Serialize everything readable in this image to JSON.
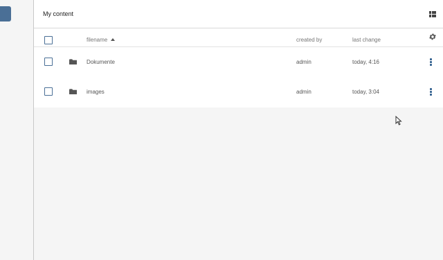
{
  "topbar": {
    "title": "My content",
    "view_toggle_icon": "grid-view-icon"
  },
  "filelist": {
    "columns": {
      "filename": "filename",
      "created_by": "created by",
      "last_change": "last change"
    },
    "sort": {
      "column": "filename",
      "direction": "ascending"
    },
    "rows": [
      {
        "name": "Dokumente",
        "created_by": "admin",
        "last_change": "today, 4:16",
        "icon": "folder-icon"
      },
      {
        "name": "images",
        "created_by": "admin",
        "last_change": "today, 3:04",
        "icon": "folder-icon"
      }
    ]
  },
  "colors": {
    "accent": "#4a6f96",
    "kebab": "#2a5a8a",
    "background": "#f5f5f5"
  }
}
